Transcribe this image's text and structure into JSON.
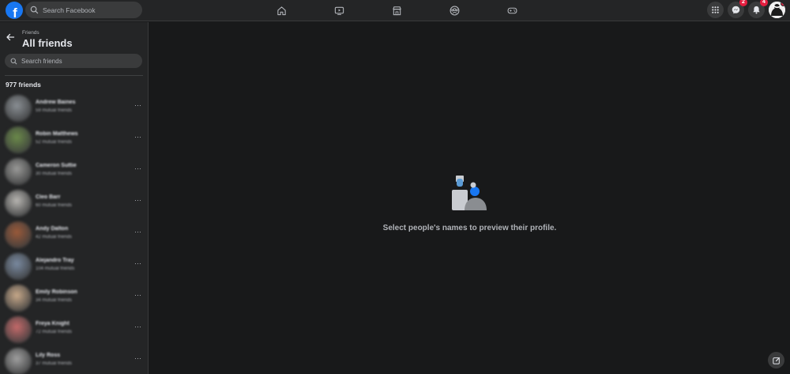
{
  "topbar": {
    "search_placeholder": "Search Facebook",
    "nav": [
      {
        "icon": "home-icon"
      },
      {
        "icon": "watch-icon"
      },
      {
        "icon": "marketplace-icon"
      },
      {
        "icon": "groups-icon"
      },
      {
        "icon": "gaming-icon"
      }
    ],
    "messenger_badge": "2",
    "notifications_badge": "4"
  },
  "sidebar": {
    "breadcrumb": "Friends",
    "title": "All friends",
    "search_placeholder": "Search friends",
    "count": "977 friends",
    "friends": [
      {
        "name": "Andrew Baines",
        "mutual": "59 mutual friends",
        "color": "#8a8f94"
      },
      {
        "name": "Robin Matthews",
        "mutual": "52 mutual friends",
        "color": "#6b8a4a"
      },
      {
        "name": "Cameron Suttie",
        "mutual": "30 mutual friends",
        "color": "#9a9a98"
      },
      {
        "name": "Cleo Barr",
        "mutual": "60 mutual friends",
        "color": "#b8b6b2"
      },
      {
        "name": "Andy Dalton",
        "mutual": "42 mutual friends",
        "color": "#9a5a3a"
      },
      {
        "name": "Alejandro Tray",
        "mutual": "104 mutual friends",
        "color": "#7a8aa0"
      },
      {
        "name": "Emily Robinson",
        "mutual": "34 mutual friends",
        "color": "#c8a98a"
      },
      {
        "name": "Freya Knight",
        "mutual": "72 mutual friends",
        "color": "#c46a6a"
      },
      {
        "name": "Lily Ross",
        "mutual": "37 mutual friends",
        "color": "#a0a0a0"
      }
    ]
  },
  "main": {
    "prompt": "Select people's names to preview their profile."
  }
}
